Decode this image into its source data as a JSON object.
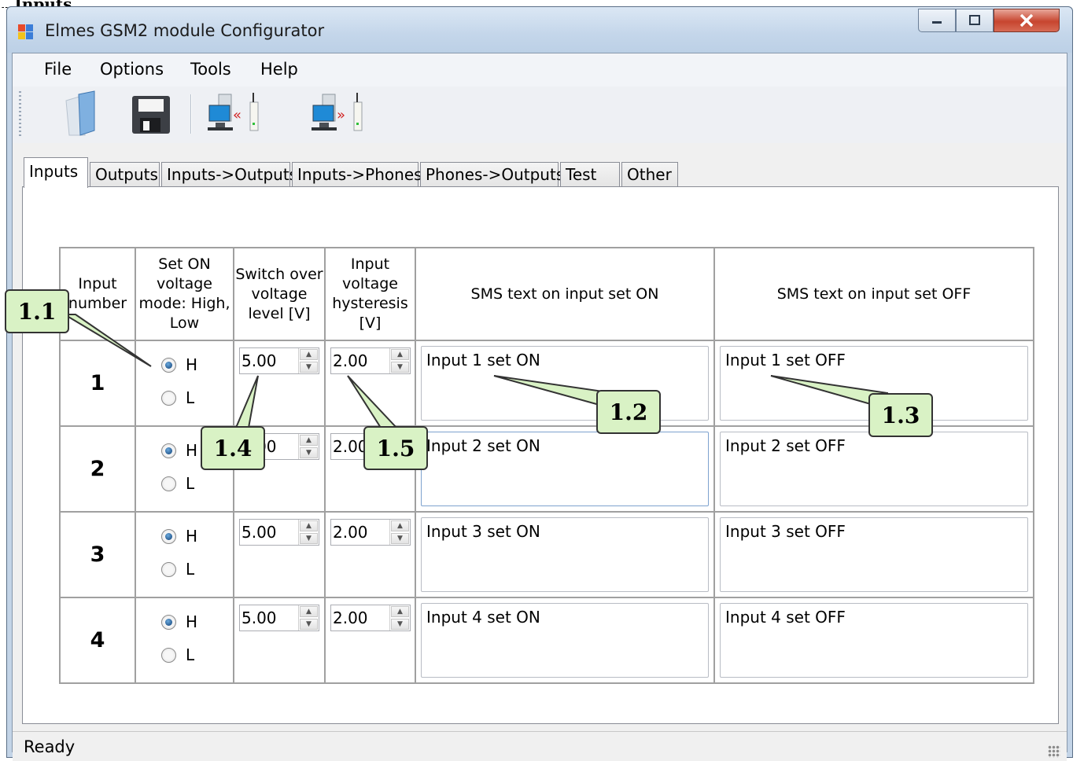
{
  "window": {
    "title": "Elmes GSM2 module Configurator"
  },
  "menu": [
    "File",
    "Options",
    "Tools",
    "Help"
  ],
  "toolbar": [
    "open-icon",
    "save-icon",
    "read-from-device-icon",
    "write-to-device-icon"
  ],
  "tabs": [
    "Inputs",
    "Outputs",
    "Inputs->Outputs",
    "Inputs->Phones",
    "Phones->Outputs",
    "Test",
    "Other"
  ],
  "active_tab": "Inputs",
  "grid": {
    "headers": [
      "Input number",
      "Set ON voltage mode: High, Low",
      "Switch over voltage level [V]",
      "Input voltage hysteresis [V]",
      "SMS text on input set ON",
      "SMS text on input set OFF"
    ],
    "radio_labels": {
      "high": "H",
      "low": "L"
    },
    "rows": [
      {
        "number": "1",
        "mode": "H",
        "level": "5.00",
        "hysteresis": "2.00",
        "sms_on": "Input 1 set ON",
        "sms_off": "Input 1 set OFF"
      },
      {
        "number": "2",
        "mode": "H",
        "level": "5.00",
        "hysteresis": "2.00",
        "sms_on": "Input 2 set ON",
        "sms_off": "Input 2 set OFF"
      },
      {
        "number": "3",
        "mode": "H",
        "level": "5.00",
        "hysteresis": "2.00",
        "sms_on": "Input 3 set ON",
        "sms_off": "Input 3 set OFF"
      },
      {
        "number": "4",
        "mode": "H",
        "level": "5.00",
        "hysteresis": "2.00",
        "sms_on": "Input 4 set ON",
        "sms_off": "Input 4 set OFF"
      }
    ]
  },
  "callouts": [
    "1.1",
    "1.2",
    "1.3",
    "1.4",
    "1.5"
  ],
  "status": {
    "text": "Ready"
  },
  "colors": {
    "callout_fill": "#d9f2c5",
    "titlebar": "#c4d6ea",
    "radio_selected": "#0f3e73"
  }
}
